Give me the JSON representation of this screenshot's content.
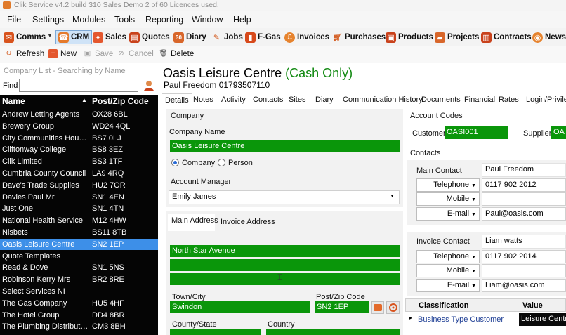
{
  "window": {
    "title": "Clik Service v4.2 build 310  Sales Demo 2 of 60 Licences used."
  },
  "menu": [
    "File",
    "Settings",
    "Modules",
    "Tools",
    "Reporting",
    "Window",
    "Help"
  ],
  "toolbar": {
    "comms": "Comms",
    "crm": "CRM",
    "sales": "Sales",
    "quotes": "Quotes",
    "diary": "Diary",
    "jobs": "Jobs",
    "fgas": "F-Gas",
    "invoices": "Invoices",
    "purchases": "Purchases",
    "products": "Products",
    "projects": "Projects",
    "contracts": "Contracts",
    "news": "News"
  },
  "actions": {
    "refresh": "Refresh",
    "new": "New",
    "save": "Save",
    "cancel": "Cancel",
    "delete": "Delete"
  },
  "left": {
    "caption": "Company List - Searching by Name",
    "find_label": "Find",
    "find_value": "",
    "col_name": "Name",
    "col_post": "Post/Zip Code",
    "rows": [
      {
        "name": "Andrew Letting Agents",
        "post": "OX28 6BL"
      },
      {
        "name": "Brewery Group",
        "post": "WD24 4QL"
      },
      {
        "name": "City Communities Housin...",
        "post": "BS7 0LJ"
      },
      {
        "name": "Cliftonway College",
        "post": "BS8 3EZ"
      },
      {
        "name": "Clik Limited",
        "post": "BS3 1TF"
      },
      {
        "name": "Cumbria County Council",
        "post": "LA9 4RQ"
      },
      {
        "name": "Dave's Trade Supplies",
        "post": "HU2 7OR"
      },
      {
        "name": "Davies Paul Mr",
        "post": "SN1 4EN"
      },
      {
        "name": "Just One",
        "post": "SN1 4TN"
      },
      {
        "name": "National Health Service",
        "post": "M12 4HW"
      },
      {
        "name": "Nisbets",
        "post": "BS11 8TB"
      },
      {
        "name": "Oasis Leisure Centre",
        "post": "SN2 1EP"
      },
      {
        "name": "Quote Templates",
        "post": ""
      },
      {
        "name": "Read & Dove",
        "post": "SN1 5NS"
      },
      {
        "name": "Robinson Kerry Mrs",
        "post": "BR2 8RE"
      },
      {
        "name": "Select Services NI",
        "post": ""
      },
      {
        "name": "The Gas Company",
        "post": "HU5 4HF"
      },
      {
        "name": "The Hotel Group",
        "post": "DD4 8BR"
      },
      {
        "name": "The Plumbing Distribution...",
        "post": "CM3 8BH"
      }
    ]
  },
  "company": {
    "name": "Oasis Leisure Centre",
    "status": "(Cash Only)",
    "contact_line": "Paul Freedom 01793507110"
  },
  "tabs": [
    "Details",
    "Notes",
    "Activity",
    "Contacts",
    "Sites",
    "Diary",
    "Communication History",
    "Documents",
    "Financial",
    "Rates",
    "Login/Privile"
  ],
  "details": {
    "company_group": "Company",
    "company_name_label": "Company Name",
    "company_name": "Oasis Leisure Centre",
    "radio_company": "Company",
    "radio_person": "Person",
    "account_manager_label": "Account Manager",
    "account_manager": "Emily James",
    "main_address_tab": "Main Address",
    "invoice_address_tab": "Invoice Address",
    "address1": "North Star Avenue",
    "address2": "",
    "address3": "",
    "town_label": "Town/City",
    "town": "Swindon",
    "post_label": "Post/Zip Code",
    "post": "SN2 1EP",
    "county_label": "County/State",
    "country_label": "Country"
  },
  "accounts": {
    "title": "Account Codes",
    "customer_label": "Customer",
    "customer_code": "OASI001",
    "supplier_label": "Supplier",
    "supplier_code": "OA"
  },
  "contacts": {
    "title": "Contacts",
    "main_label": "Main Contact",
    "main_name": "Paul Freedom",
    "main_telephone_type": "Telephone",
    "main_telephone": "0117 902 2012",
    "main_mobile_type": "Mobile",
    "main_mobile": "",
    "main_email_type": "E-mail",
    "main_email": "Paul@oasis.com",
    "invoice_label": "Invoice Contact",
    "invoice_name": "Liam watts",
    "invoice_telephone_type": "Telephone",
    "invoice_telephone": "0117 902 2014",
    "invoice_mobile_type": "Mobile",
    "invoice_mobile": "",
    "invoice_email_type": "E-mail",
    "invoice_email": "Liam@oasis.com"
  },
  "classification": {
    "col_class": "Classification",
    "col_value": "Value",
    "row_class": "Business Type Customer",
    "row_value": "Leisure Centr"
  },
  "colors": {
    "green": "#0a960a",
    "selected_row": "#3d8fe8",
    "list_bg": "#050505"
  }
}
